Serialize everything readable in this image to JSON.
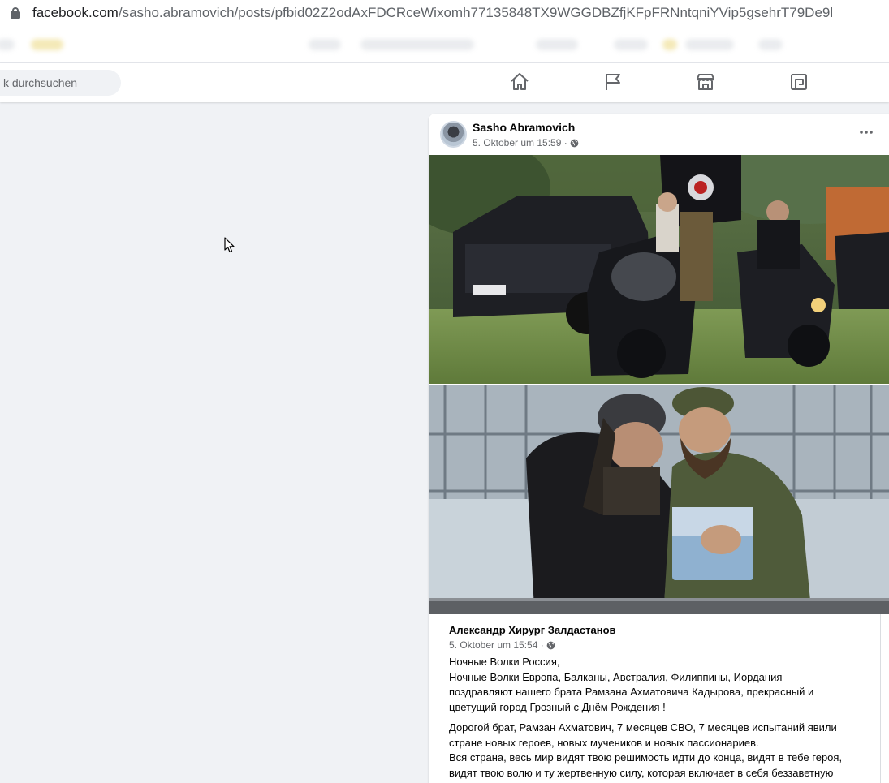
{
  "browser": {
    "url_host": "facebook.com",
    "url_path": "/sasho.abramovich/posts/pfbid02Z2odAxFDCRceWixomh77135848TX9WGGDBZfjKFpFRNntqniYVip5gsehrT79De9l"
  },
  "topnav": {
    "search_placeholder": "k durchsuchen",
    "icons": [
      "home-icon",
      "pages-flag-icon",
      "marketplace-icon",
      "gaming-icon"
    ]
  },
  "post": {
    "author": "Sasho Abramovich",
    "timestamp": "5. Oktober um 15:59 ·",
    "privacy_icon": "globe-icon",
    "menu_icon": "more-horizontal-icon",
    "shared": {
      "author": "Александр Хирург Залдастанов",
      "timestamp": "5. Oktober um 15:54 ·",
      "paragraph1": [
        "Ночные Волки Россия,",
        "Ночные Волки Европа, Балканы, Австралия, Филиппины, Иордания",
        "поздравляют нашего брата Рамзана Ахматовича Кадырова, прекрасный и",
        "цветущий город Грозный с Днём Рождения !"
      ],
      "paragraph2": [
        "Дорогой брат, Рамзан Ахматович, 7 месяцев СВО, 7 месяцев испытаний явили",
        "стране новых героев, новых мучеников и новых пассионариев.",
        "Вся страна, весь мир видят твою решимость идти до конца, видят в тебе героя,",
        "видят твою волю и ту жертвенную силу, которая включает в себя беззаветную"
      ]
    }
  },
  "colors": {
    "page_bg": "#f0f2f5",
    "card_bg": "#ffffff",
    "secondary_text": "#65676b",
    "nav_icon": "#65676b"
  }
}
